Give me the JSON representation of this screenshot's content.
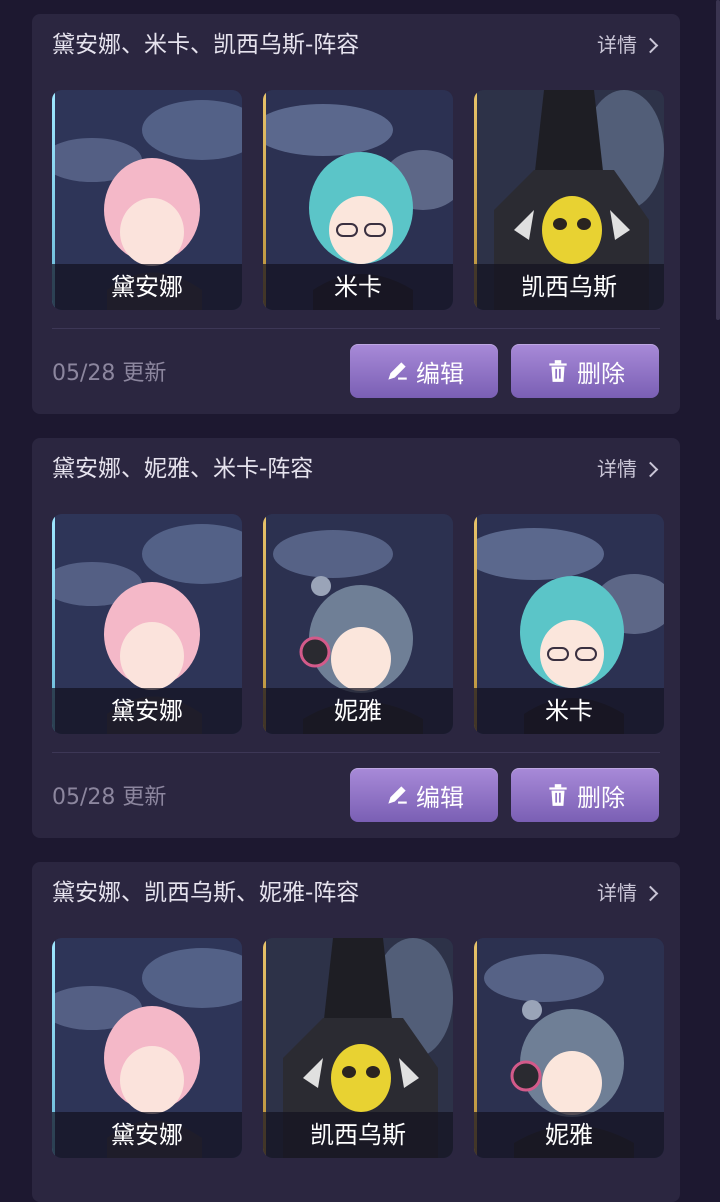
{
  "cards": [
    {
      "title": "黛安娜、米卡、凯西乌斯-阵容",
      "detail_label": "详情",
      "members": [
        "黛安娜",
        "米卡",
        "凯西乌斯"
      ],
      "date": "05/28 更新",
      "edit_label": "编辑",
      "delete_label": "删除"
    },
    {
      "title": "黛安娜、妮雅、米卡-阵容",
      "detail_label": "详情",
      "members": [
        "黛安娜",
        "妮雅",
        "米卡"
      ],
      "date": "05/28 更新",
      "edit_label": "编辑",
      "delete_label": "删除"
    },
    {
      "title": "黛安娜、凯西乌斯、妮雅-阵容",
      "detail_label": "详情",
      "members": [
        "黛安娜",
        "凯西乌斯",
        "妮雅"
      ]
    }
  ],
  "colors": {
    "background": "#1d1830",
    "card": "#2b2640",
    "button": "#8f73c6"
  },
  "icons": [
    "chevron-right-icon",
    "pencil-icon",
    "trash-icon"
  ]
}
